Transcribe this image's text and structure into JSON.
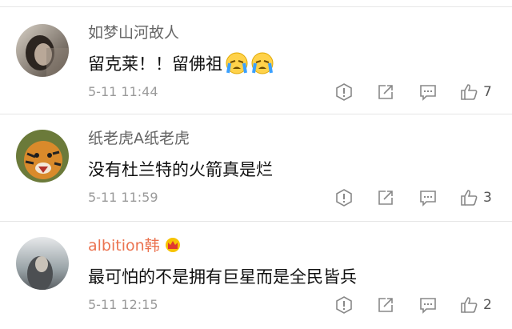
{
  "comments": [
    {
      "username": "如梦山河故人",
      "text": "留克莱！！留佛祖",
      "emoji": [
        "crying-face",
        "crying-face"
      ],
      "time": "5-11 11:44",
      "likes": "7",
      "vip": false
    },
    {
      "username": "纸老虎A纸老虎",
      "text": "没有杜兰特的火箭真是烂",
      "emoji": [],
      "time": "5-11 11:59",
      "likes": "3",
      "vip": false
    },
    {
      "username": "albition韩",
      "text": "最可怕的不是拥有巨星而是全民皆兵",
      "emoji": [],
      "time": "5-11 12:15",
      "likes": "2",
      "vip": true
    }
  ],
  "actions": [
    "report-icon",
    "share-icon",
    "reply-icon",
    "thumbs-up-icon"
  ],
  "colors": {
    "vip_username": "#eb7350",
    "username": "#666666",
    "text": "#111111",
    "meta": "#9a9a9a"
  }
}
